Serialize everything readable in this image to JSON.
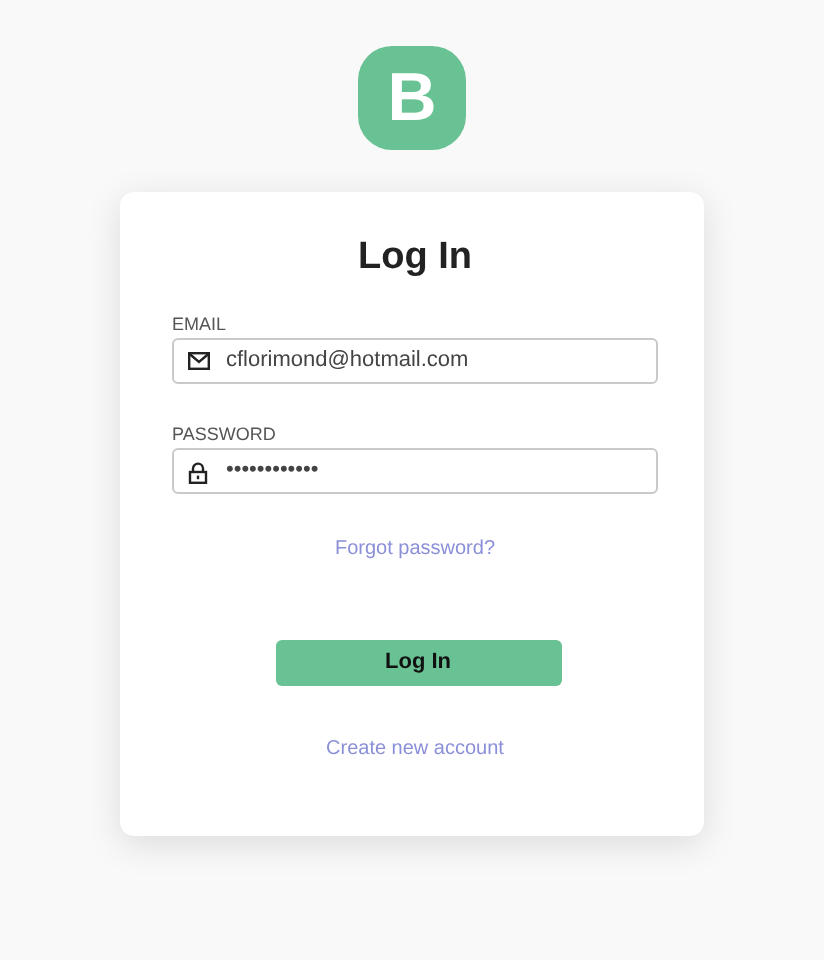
{
  "logo": {
    "letter": "B"
  },
  "title": "Log In",
  "fields": [
    {
      "label": "EMAIL",
      "kind": "email",
      "value": "cflorimond@hotmail.com"
    },
    {
      "label": "PASSWORD",
      "kind": "password",
      "value": "••••••••••••"
    }
  ],
  "forgot_link": "Forgot password?",
  "submit_button": "Log In",
  "create_link": "Create new account"
}
